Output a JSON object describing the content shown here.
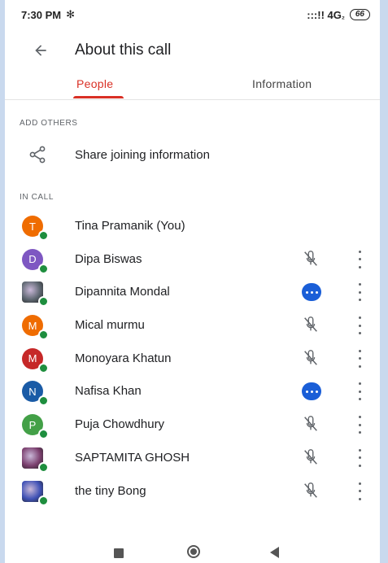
{
  "status_bar": {
    "time": "7:30 PM",
    "bt_glyph": "✻",
    "signal": ":::!! 4G",
    "network_badge": "₂",
    "battery": "66"
  },
  "app_bar": {
    "title": "About this call",
    "back_icon": "arrow-left-icon"
  },
  "tabs": [
    {
      "label": "People",
      "active": true
    },
    {
      "label": "Information",
      "active": false
    }
  ],
  "add_others": {
    "section_label": "ADD OTHERS",
    "share_label": "Share joining information",
    "icon": "share-icon"
  },
  "in_call": {
    "section_label": "IN CALL"
  },
  "colors": {
    "accent": "#d93025",
    "presence": "#1e8e3e",
    "talking": "#1a5ed7",
    "status_bg": "#c9d9ee"
  },
  "participants": [
    {
      "name": "Tina Pramanik (You)",
      "initial": "T",
      "avatar_color": "#ef6c00",
      "photo": false,
      "status": "none"
    },
    {
      "name": "Dipa Biswas",
      "initial": "D",
      "avatar_color": "#7e57c2",
      "photo": false,
      "status": "muted"
    },
    {
      "name": "Dipannita Mondal",
      "initial": "",
      "avatar_color": "#5d6670",
      "photo": true,
      "status": "talking"
    },
    {
      "name": "Mical murmu",
      "initial": "M",
      "avatar_color": "#ef6c00",
      "photo": false,
      "status": "muted"
    },
    {
      "name": "Monoyara Khatun",
      "initial": "M",
      "avatar_color": "#c62828",
      "photo": false,
      "status": "muted"
    },
    {
      "name": "Nafisa Khan",
      "initial": "N",
      "avatar_color": "#1a5ba6",
      "photo": false,
      "status": "talking"
    },
    {
      "name": "Puja Chowdhury",
      "initial": "P",
      "avatar_color": "#43a047",
      "photo": false,
      "status": "muted"
    },
    {
      "name": "SAPTAMITA GHOSH",
      "initial": "",
      "avatar_color": "#7b3f6e",
      "photo": true,
      "status": "muted"
    },
    {
      "name": "the tiny Bong",
      "initial": "",
      "avatar_color": "#3f51b5",
      "photo": true,
      "status": "muted"
    }
  ],
  "nav_bar": {
    "recents": "square-icon",
    "home": "circle-icon",
    "back": "triangle-back-icon"
  }
}
